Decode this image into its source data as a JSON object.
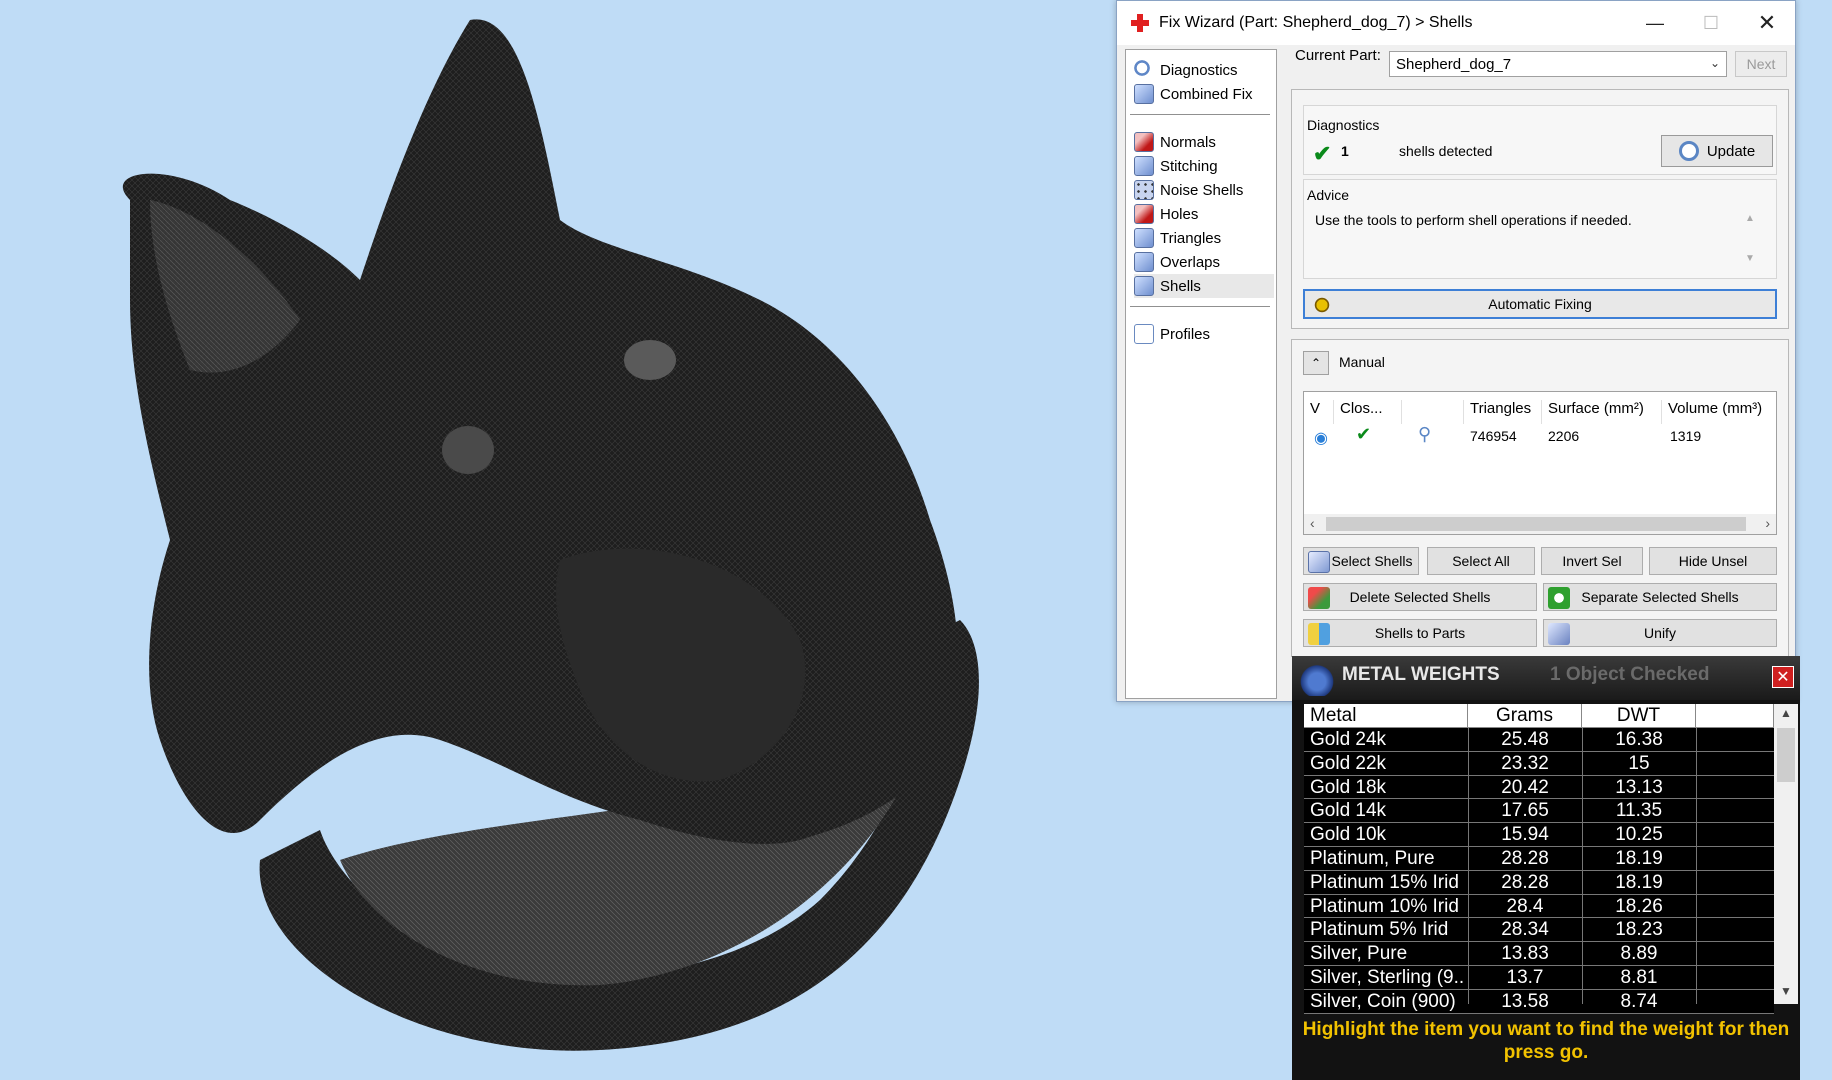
{
  "wizard": {
    "title": "Fix Wizard (Part: Shepherd_dog_7) > Shells",
    "controls": {
      "minimize": "—",
      "maximize": "☐",
      "close": "✕"
    },
    "nav": {
      "top": [
        "Diagnostics",
        "Combined Fix"
      ],
      "tools": [
        "Normals",
        "Stitching",
        "Noise Shells",
        "Holes",
        "Triangles",
        "Overlaps",
        "Shells"
      ],
      "bottom": [
        "Profiles"
      ],
      "selected": "Shells"
    },
    "current_part_label": "Current Part:",
    "current_part_value": "Shepherd_dog_7",
    "next_label": "Next",
    "diagnostics": {
      "heading": "Diagnostics",
      "count": "1",
      "text": "shells detected",
      "update_label": "Update"
    },
    "advice": {
      "heading": "Advice",
      "text": "Use the tools to perform shell operations if needed."
    },
    "automatic_fixing_label": "Automatic Fixing",
    "manual": {
      "toggle": "⌃",
      "label": "Manual",
      "columns": [
        "V",
        "Clos...",
        "",
        "Triangles",
        "Surface (mm²)",
        "Volume (mm³)"
      ],
      "row": {
        "triangles": "746954",
        "surface": "2206",
        "volume": "1319"
      }
    },
    "buttons": {
      "select_shells": "Select Shells",
      "select_all": "Select All",
      "invert_sel": "Invert Sel",
      "hide_unsel": "Hide Unsel",
      "delete_selected": "Delete Selected Shells",
      "separate_selected": "Separate Selected Shells",
      "shells_to_parts": "Shells to Parts",
      "unify": "Unify"
    }
  },
  "metal_weights": {
    "title": "METAL WEIGHTS",
    "subtitle": "1 Object Checked",
    "close": "✕",
    "columns": [
      "Metal",
      "Grams",
      "DWT"
    ],
    "rows": [
      {
        "metal": "Gold 24k",
        "grams": "25.48",
        "dwt": "16.38"
      },
      {
        "metal": "Gold 22k",
        "grams": "23.32",
        "dwt": "15"
      },
      {
        "metal": "Gold 18k",
        "grams": "20.42",
        "dwt": "13.13"
      },
      {
        "metal": "Gold 14k",
        "grams": "17.65",
        "dwt": "11.35"
      },
      {
        "metal": "Gold 10k",
        "grams": "15.94",
        "dwt": "10.25"
      },
      {
        "metal": "Platinum, Pure",
        "grams": "28.28",
        "dwt": "18.19"
      },
      {
        "metal": "Platinum 15% Irid",
        "grams": "28.28",
        "dwt": "18.19"
      },
      {
        "metal": "Platinum 10% Irid",
        "grams": "28.4",
        "dwt": "18.26"
      },
      {
        "metal": "Platinum 5% Irid",
        "grams": "28.34",
        "dwt": "18.23"
      },
      {
        "metal": "Silver, Pure",
        "grams": "13.83",
        "dwt": "8.89"
      },
      {
        "metal": "Silver, Sterling (9...",
        "grams": "13.7",
        "dwt": "8.81"
      },
      {
        "metal": "Silver, Coin (900)",
        "grams": "13.58",
        "dwt": "8.74"
      }
    ],
    "hint": "Highlight the item you want to find the weight for then press go."
  }
}
